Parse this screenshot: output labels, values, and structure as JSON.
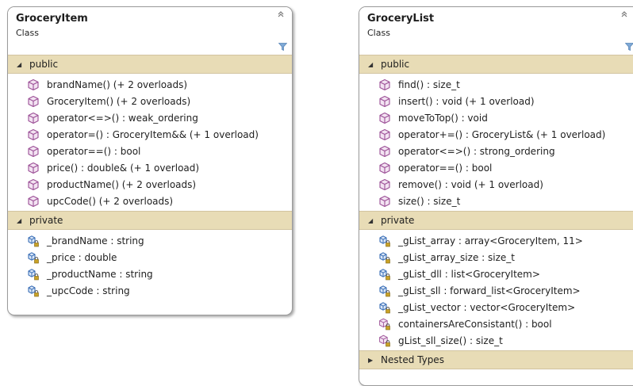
{
  "shapes": {
    "grocery_item": {
      "title": "GroceryItem",
      "subtitle": "Class",
      "public": {
        "label": "public",
        "members": [
          {
            "text": "brandName() (+ 2 overloads)",
            "icon": "method-icon"
          },
          {
            "text": "GroceryItem() (+ 2 overloads)",
            "icon": "method-icon"
          },
          {
            "text": "operator<=>() : weak_ordering",
            "icon": "method-icon"
          },
          {
            "text": "operator=() : GroceryItem&& (+ 1 overload)",
            "icon": "method-icon"
          },
          {
            "text": "operator==() : bool",
            "icon": "method-icon"
          },
          {
            "text": "price() : double& (+ 1 overload)",
            "icon": "method-icon"
          },
          {
            "text": "productName() (+ 2 overloads)",
            "icon": "method-icon"
          },
          {
            "text": "upcCode() (+ 2 overloads)",
            "icon": "method-icon"
          }
        ]
      },
      "private": {
        "label": "private",
        "members": [
          {
            "text": "_brandName : string",
            "icon": "private-field-icon"
          },
          {
            "text": "_price : double",
            "icon": "private-field-icon"
          },
          {
            "text": "_productName : string",
            "icon": "private-field-icon"
          },
          {
            "text": "_upcCode : string",
            "icon": "private-field-icon"
          }
        ]
      }
    },
    "grocery_list": {
      "title": "GroceryList",
      "subtitle": "Class",
      "public": {
        "label": "public",
        "members": [
          {
            "text": "find() : size_t",
            "icon": "method-icon"
          },
          {
            "text": "insert() : void (+ 1 overload)",
            "icon": "method-icon"
          },
          {
            "text": "moveToTop() : void",
            "icon": "method-icon"
          },
          {
            "text": "operator+=() : GroceryList& (+ 1 overload)",
            "icon": "method-icon"
          },
          {
            "text": "operator<=>() : strong_ordering",
            "icon": "method-icon"
          },
          {
            "text": "operator==() : bool",
            "icon": "method-icon"
          },
          {
            "text": "remove() : void (+ 1 overload)",
            "icon": "method-icon"
          },
          {
            "text": "size() : size_t",
            "icon": "method-icon"
          }
        ]
      },
      "private": {
        "label": "private",
        "members": [
          {
            "text": "_gList_array : array<GroceryItem, 11>",
            "icon": "private-field-icon"
          },
          {
            "text": "_gList_array_size : size_t",
            "icon": "private-field-icon"
          },
          {
            "text": "_gList_dll : list<GroceryItem>",
            "icon": "private-field-icon"
          },
          {
            "text": "_gList_sll : forward_list<GroceryItem>",
            "icon": "private-field-icon"
          },
          {
            "text": "_gList_vector : vector<GroceryItem>",
            "icon": "private-field-icon"
          },
          {
            "text": "containersAreConsistant() : bool",
            "icon": "private-method-icon"
          },
          {
            "text": "gList_sll_size() : size_t",
            "icon": "private-method-icon"
          }
        ]
      },
      "nested": {
        "label": "Nested Types"
      }
    }
  },
  "colors": {
    "section_header": "#e8dcb6",
    "method_icon": "#9b4f96",
    "field_icon": "#3b6fb6",
    "lock": "#c9a227"
  }
}
